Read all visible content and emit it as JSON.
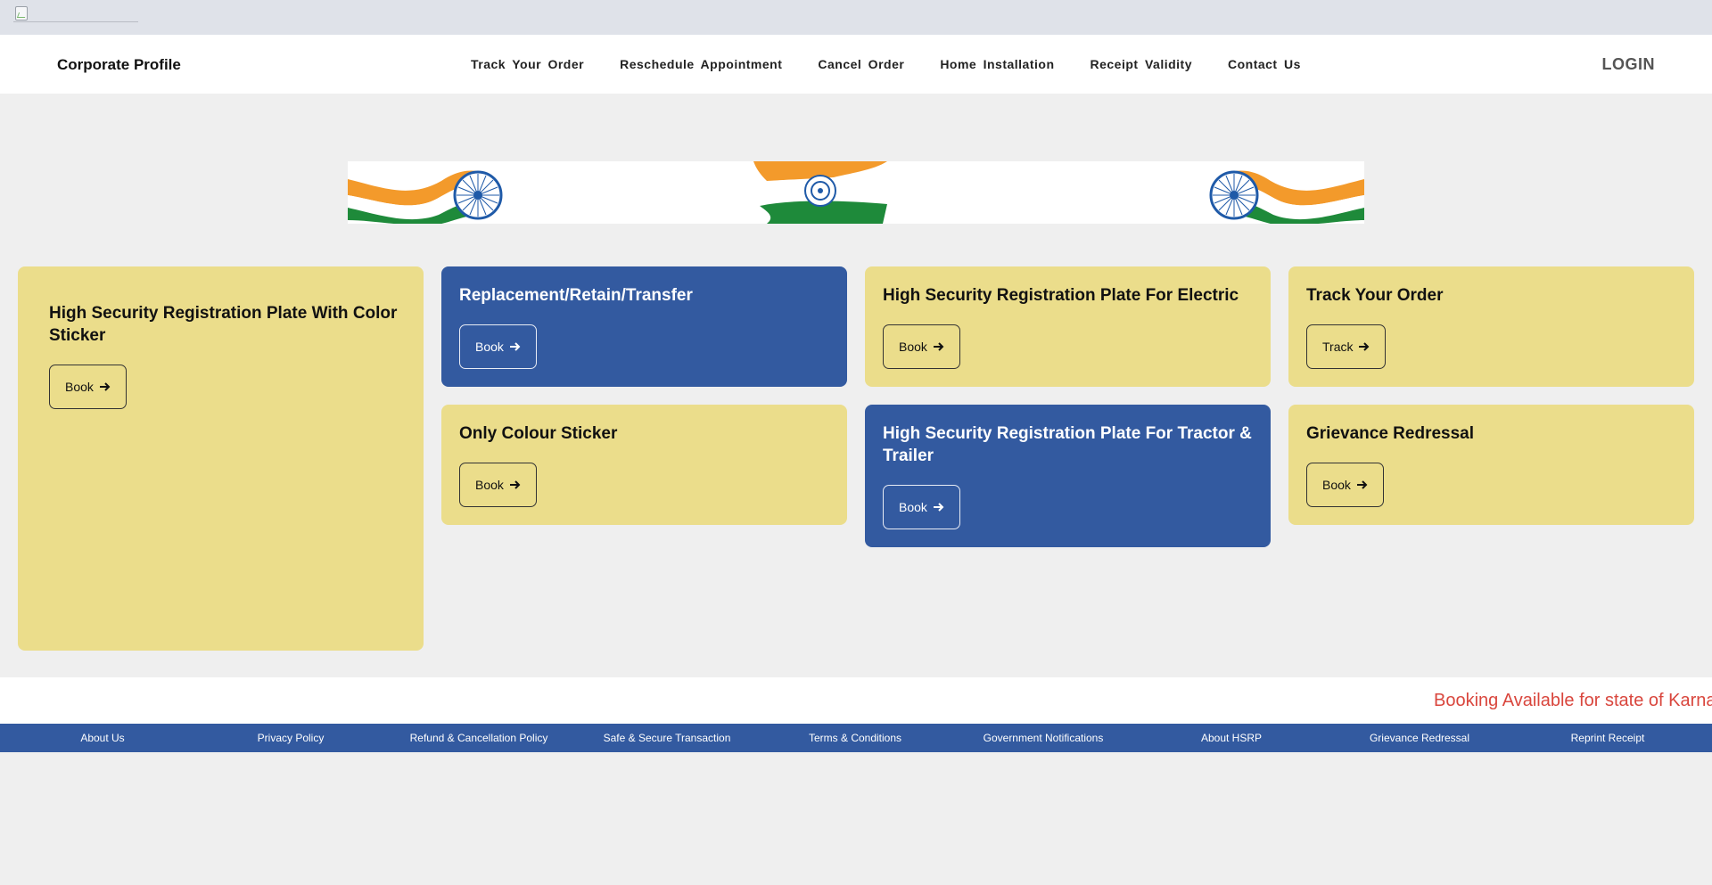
{
  "topbar": {
    "logo_icon": "broken-image-icon"
  },
  "navbar": {
    "brand": "Corporate Profile",
    "links": [
      "Track Your Order",
      "Reschedule Appointment",
      "Cancel Order",
      "Home Installation",
      "Receipt Validity",
      "Contact Us"
    ],
    "login": "LOGIN"
  },
  "banner": {
    "flag_colors": {
      "saffron": "#f39a2b",
      "white": "#ffffff",
      "green": "#1e8a3a",
      "chakra": "#1f5aa8"
    }
  },
  "cards": {
    "hsrp_color_sticker": {
      "title": "High Security Registration Plate With Color Sticker",
      "button": "Book"
    },
    "replacement": {
      "title": "Replacement/Retain/Transfer",
      "button": "Book"
    },
    "hsrp_electric": {
      "title": "High Security Registration Plate For Electric",
      "button": "Book"
    },
    "track_order": {
      "title": "Track Your Order",
      "button": "Track"
    },
    "colour_sticker": {
      "title": "Only Colour Sticker",
      "button": "Book"
    },
    "hsrp_tractor": {
      "title": "High Security Registration Plate For Tractor & Trailer",
      "button": "Book"
    },
    "grievance": {
      "title": "Grievance Redressal",
      "button": "Book"
    }
  },
  "ticker": {
    "text": "Booking Available for state of Karna"
  },
  "footer": {
    "links": [
      "About Us",
      "Privacy Policy",
      "Refund & Cancellation Policy",
      "Safe & Secure Transaction",
      "Terms & Conditions",
      "Government Notifications",
      "About HSRP",
      "Grievance Redressal",
      "Reprint Receipt"
    ]
  },
  "colors": {
    "yellow_card": "#ebdd8b",
    "blue_card": "#335aa0",
    "ticker_red": "#d9463d",
    "footer_bg": "#335aa0"
  }
}
